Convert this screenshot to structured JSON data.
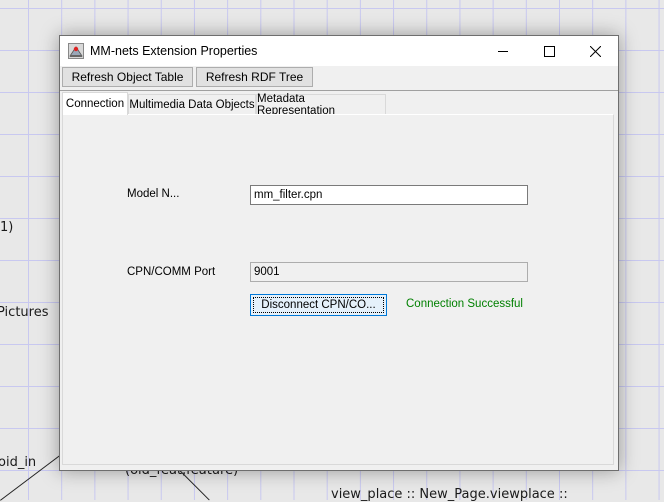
{
  "background": {
    "texts": [
      "1)",
      "Pictures",
      "oid_in",
      "(old_feat,feature)",
      "view_place :: New_Page.viewplace ::"
    ]
  },
  "window": {
    "title": "MM-nets Extension Properties",
    "icon": "java-app-icon",
    "controls": {
      "minimize": "minimize-icon",
      "maximize": "maximize-icon",
      "close": "close-icon"
    }
  },
  "toolbar": {
    "refresh_object_table": "Refresh Object Table",
    "refresh_rdf_tree": "Refresh RDF Tree"
  },
  "tabs": [
    {
      "label": "Connection",
      "active": true
    },
    {
      "label": "Multimedia Data Objects",
      "active": false
    },
    {
      "label": "Metadata Representation",
      "active": false
    }
  ],
  "connection": {
    "model_name_label": "Model N...",
    "model_name_value": "mm_filter.cpn",
    "port_label": "CPN/COMM Port",
    "port_value": "9001",
    "disconnect_button": "Disconnect CPN/CO...",
    "status_text": "Connection Successful",
    "status_color": "#008000"
  }
}
